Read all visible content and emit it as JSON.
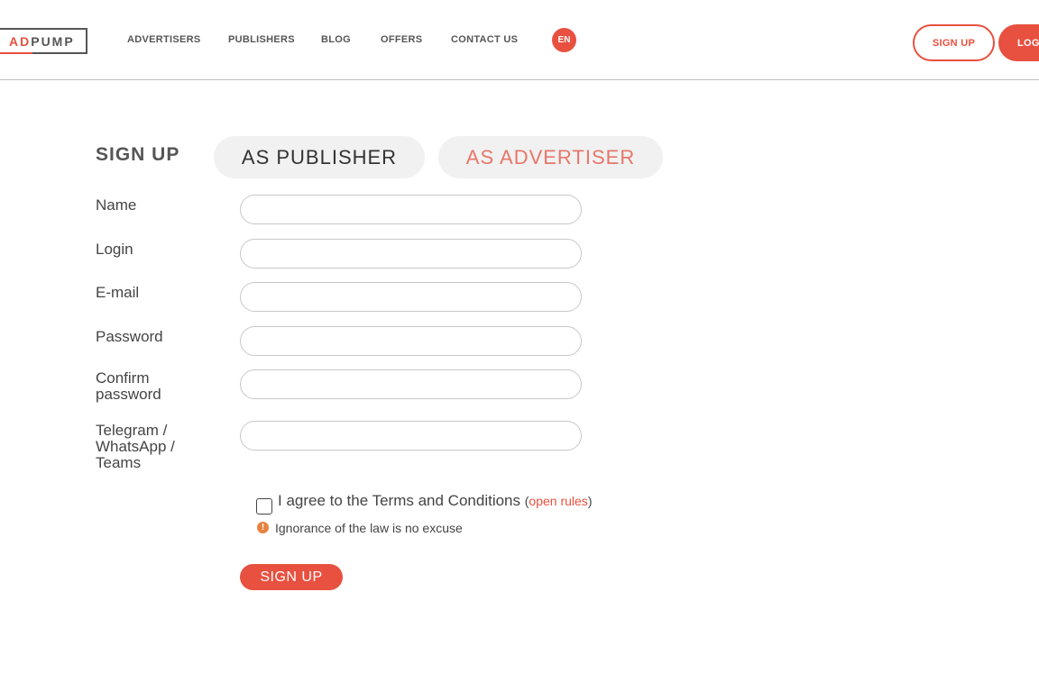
{
  "header": {
    "logo": {
      "part1": "AD",
      "part2": "PUMP"
    },
    "nav": [
      "ADVERTISERS",
      "PUBLISHERS",
      "BLOG",
      "OFFERS",
      "CONTACT US"
    ],
    "lang": "EN",
    "signup_label": "SIGN UP",
    "login_label": "LOG"
  },
  "form": {
    "title": "SIGN UP",
    "tabs": {
      "publisher": "AS PUBLISHER",
      "advertiser": "AS ADVERTISER"
    },
    "fields": [
      {
        "label": "Name",
        "value": ""
      },
      {
        "label": "Login",
        "value": ""
      },
      {
        "label": "E-mail",
        "value": ""
      },
      {
        "label": "Password",
        "value": ""
      },
      {
        "label": "Confirm password",
        "value": ""
      },
      {
        "label": "Telegram / WhatsApp / Teams",
        "value": ""
      }
    ],
    "agree_text": "I agree to the Terms and Conditions",
    "paren_open": "(",
    "rules_link": "open rules",
    "paren_close": ")",
    "warning": "Ignorance of the law is no excuse",
    "submit": "SIGN UP"
  },
  "colors": {
    "accent": "#e8503f",
    "warning": "#e8823f",
    "tab_bg": "#f1f1f1"
  },
  "icons": {
    "warning": "exclamation-circle-icon"
  }
}
